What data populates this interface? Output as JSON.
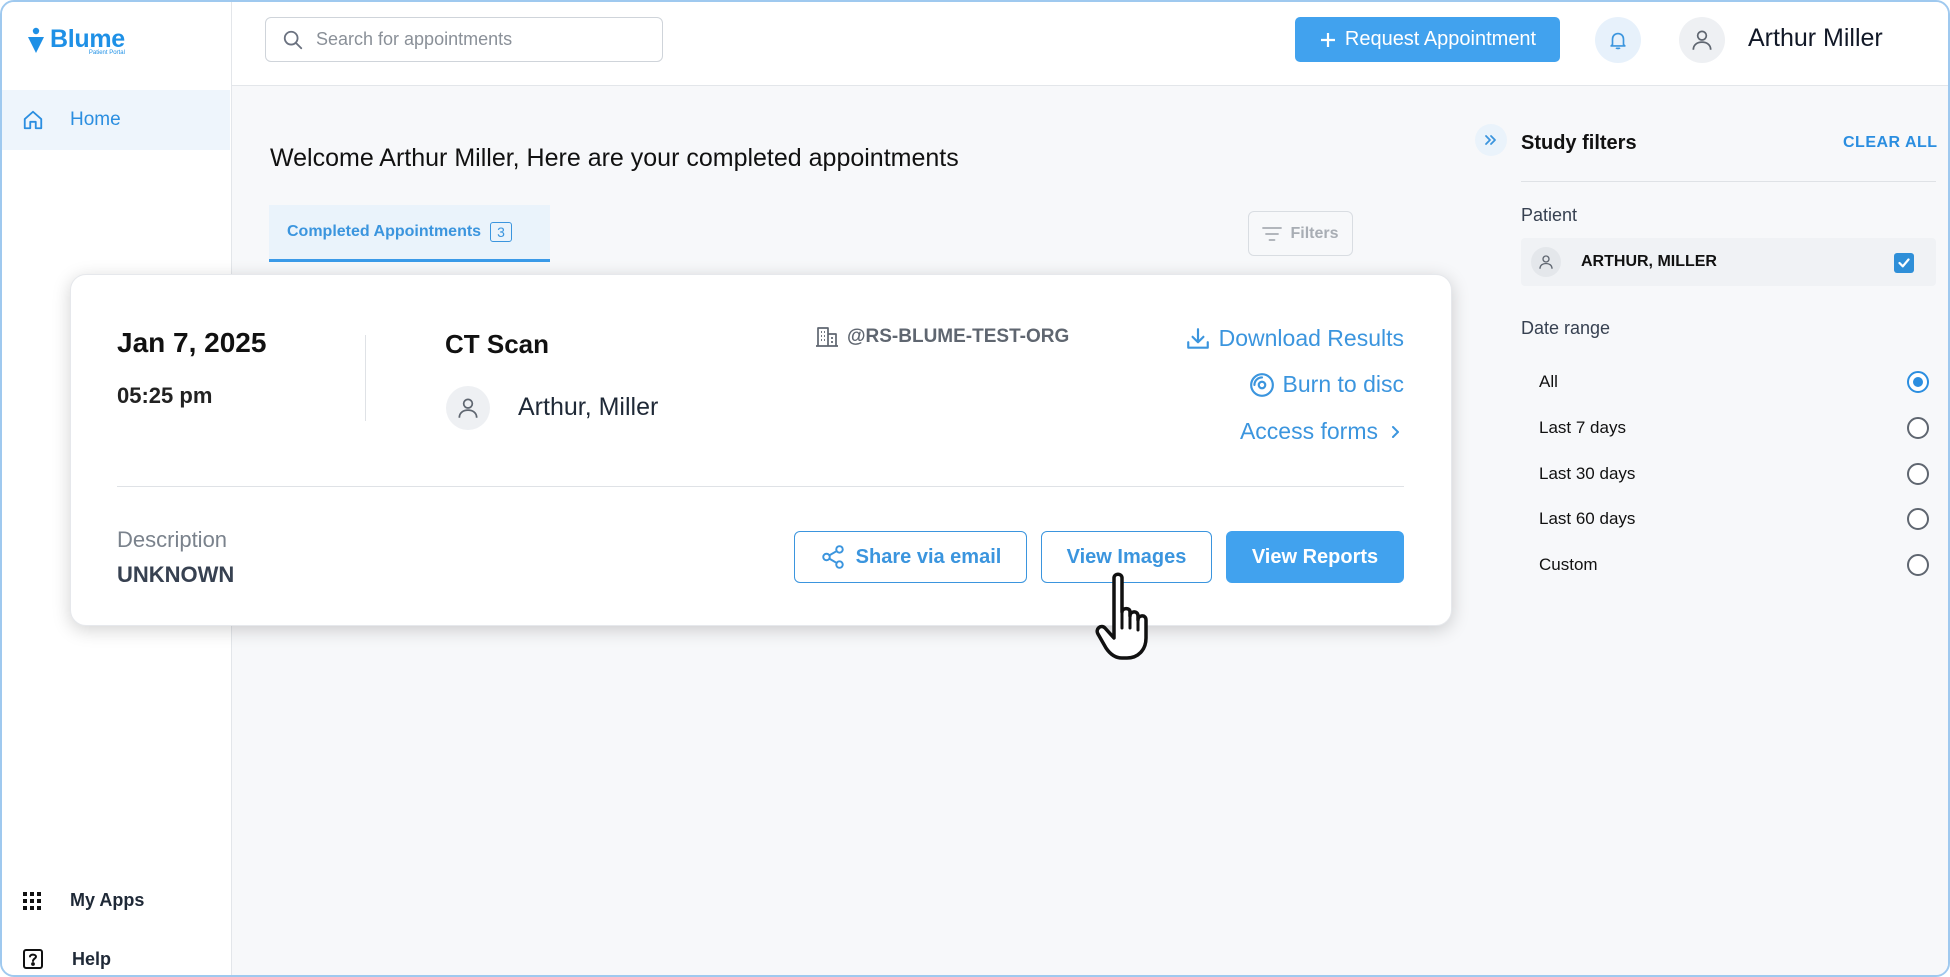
{
  "app": {
    "name": "Blume",
    "subtitle": "Patient Portal"
  },
  "sidebar": {
    "items": [
      {
        "label": "Home",
        "icon": "home-icon",
        "active": true
      }
    ],
    "bottom_items": [
      {
        "label": "My Apps",
        "icon": "apps-grid-icon"
      },
      {
        "label": "Help",
        "icon": "help-icon"
      }
    ]
  },
  "header": {
    "search_placeholder": "Search for appointments",
    "request_button": "Request Appointment",
    "user_name": "Arthur Miller"
  },
  "main": {
    "title": "Welcome Arthur Miller, Here are your completed appointments",
    "tab": {
      "label": "Completed Appointments",
      "count": "3"
    },
    "filters_button": "Filters"
  },
  "appointment": {
    "date": "Jan 7, 2025",
    "time": "05:25 pm",
    "study": "CT Scan",
    "patient": "Arthur, Miller",
    "organization": "@RS-BLUME-TEST-ORG",
    "actions": {
      "download": "Download Results",
      "burn": "Burn to disc",
      "access_forms": "Access forms"
    },
    "description_label": "Description",
    "description_value": "UNKNOWN",
    "buttons": {
      "share": "Share via email",
      "view_images": "View Images",
      "view_reports": "View Reports"
    }
  },
  "filters_panel": {
    "title": "Study filters",
    "clear_all": "CLEAR ALL",
    "patient_label": "Patient",
    "patient_name": "ARTHUR, MILLER",
    "patient_checked": true,
    "date_range_label": "Date range",
    "date_options": [
      {
        "label": "All",
        "selected": true
      },
      {
        "label": "Last 7 days",
        "selected": false
      },
      {
        "label": "Last 30 days",
        "selected": false
      },
      {
        "label": "Last 60 days",
        "selected": false
      },
      {
        "label": "Custom",
        "selected": false
      }
    ]
  },
  "colors": {
    "accent": "#41a2ee",
    "link": "#3b95de",
    "brand": "#1e90e6"
  }
}
